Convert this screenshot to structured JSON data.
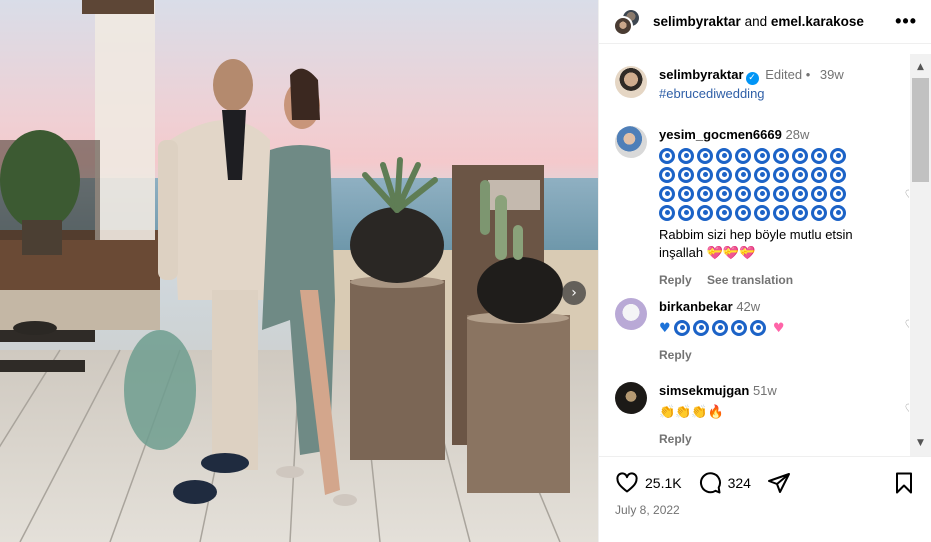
{
  "header": {
    "user1": "selimbyraktar",
    "and_text": "and",
    "user2": "emel.karakose",
    "more_icon": "more-horizontal-icon"
  },
  "caption": {
    "username": "selimbyraktar",
    "verified": "✓",
    "edited": "Edited",
    "separator": "•",
    "time": "39w",
    "hashtag": "#ebrucediwedding"
  },
  "comments": [
    {
      "username": "yesim_gocmen6669",
      "time": "28w",
      "text": "Rabbim sizi hep böyle mutlu etsin",
      "text2": "inşallah",
      "reply": "Reply",
      "translate": "See translation"
    },
    {
      "username": "birkanbekar",
      "time": "42w",
      "reply": "Reply"
    },
    {
      "username": "simsekmujgan",
      "time": "51w",
      "reply": "Reply"
    }
  ],
  "footer": {
    "likes": "25.1K",
    "comments": "324",
    "date": "July 8, 2022"
  },
  "colors": {
    "link": "#2f5fa7",
    "verified": "#0095f6",
    "muted": "#737373",
    "evil_eye": "#1c63c7"
  }
}
